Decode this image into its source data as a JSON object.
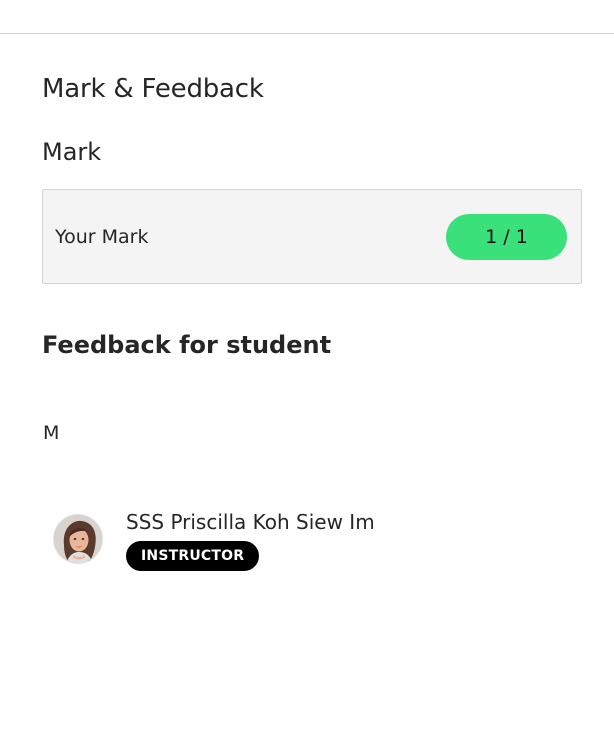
{
  "panel": {
    "title": "Mark & Feedback"
  },
  "mark_section": {
    "title": "Mark",
    "label": "Your Mark",
    "score": "1 / 1",
    "score_color": "#3ae07a"
  },
  "feedback_section": {
    "title": "Feedback for student",
    "text": "M"
  },
  "author": {
    "name": "SSS Priscilla Koh Siew Im",
    "role": "INSTRUCTOR"
  }
}
